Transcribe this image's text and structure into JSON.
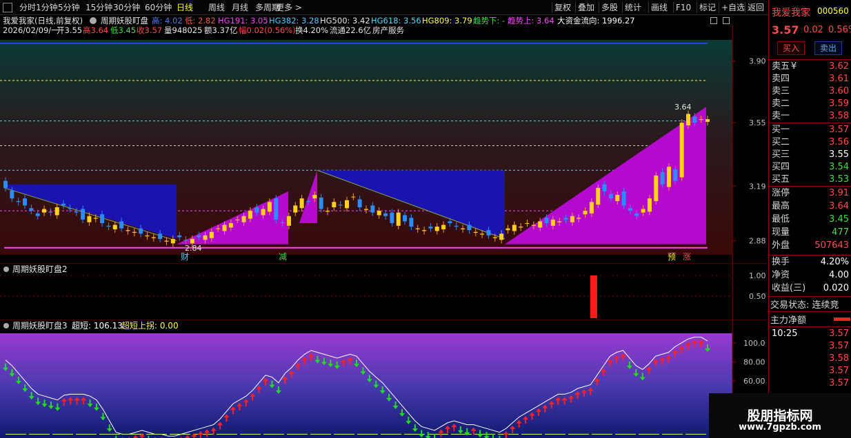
{
  "toolbar": {
    "left": [
      "分时",
      "1分钟",
      "5分钟",
      "15分钟",
      "30分钟",
      "60分钟",
      "日线",
      "周线",
      "月线",
      "多周期",
      "更多 >"
    ],
    "active": "日线",
    "right": [
      "复权",
      "叠加",
      "多股",
      "统计",
      "画线",
      "F10",
      "标记",
      "+自选",
      "返回"
    ]
  },
  "info": {
    "stock": "我爱我家(日线,前复权)",
    "indicator": "周期妖股盯盘",
    "high_label": "高: 4.02",
    "low_label": "低: 2.82",
    "hg191": "HG191: 3.05",
    "hg382": "HG382: 3.28",
    "hg500": "HG500: 3.42",
    "hg618": "HG618: 3.56",
    "hg809": "HG809: 3.79",
    "trend_down": "趋势下: -",
    "trend_up": "趋势上: 3.64",
    "fund_flow": "大资金流向: 1996.27",
    "date": "2026/02/09/一",
    "open": "开3.55",
    "high": "高3.64",
    "low": "低3.45",
    "close": "收3.57",
    "volume": "量948025",
    "amount": "额3.37亿",
    "change": "幅0.02(0.56%)",
    "turnover": "换4.20%",
    "float": "流通22.6亿",
    "sector": "房产服务"
  },
  "price_axis": [
    "3.90",
    "3.55",
    "3.19",
    "2.88"
  ],
  "chart_labels": {
    "low_mark": "2.84",
    "high_mark": "3.64"
  },
  "markers": [
    "财",
    "减",
    "预",
    "涨"
  ],
  "panel2": {
    "title": "周期妖股盯盘2",
    "axis": [
      "1.00",
      "0.50"
    ]
  },
  "panel3": {
    "title": "周期妖股盯盘3",
    "super_short": "超短: 106.13",
    "super_short_up": "超短上拐: 0.00",
    "axis": [
      "100.0",
      "80.00",
      "60.00"
    ]
  },
  "quote": {
    "name": "我爱我家",
    "code": "000560",
    "price": "3.57",
    "change": "0.02",
    "pct": "0.56%",
    "buy_btn": "买入",
    "sell_btn": "卖出",
    "asks": [
      {
        "label": "卖五",
        "extra": "¥",
        "price": "3.62"
      },
      {
        "label": "卖四",
        "price": "3.61"
      },
      {
        "label": "卖三",
        "price": "3.60"
      },
      {
        "label": "卖二",
        "price": "3.59"
      },
      {
        "label": "卖一",
        "price": "3.58"
      }
    ],
    "bids": [
      {
        "label": "买一",
        "price": "3.57"
      },
      {
        "label": "买二",
        "price": "3.56"
      },
      {
        "label": "买三",
        "price": "3.55"
      },
      {
        "label": "买四",
        "price": "3.54"
      },
      {
        "label": "买五",
        "price": "3.53"
      }
    ],
    "stats": [
      {
        "label": "涨停",
        "value": "3.91"
      },
      {
        "label": "最高",
        "value": "3.64"
      },
      {
        "label": "最低",
        "value": "3.45"
      },
      {
        "label": "现量",
        "value": "477"
      },
      {
        "label": "外盘",
        "value": "507643"
      }
    ],
    "stats2": [
      {
        "label": "换手",
        "value": "4.20%"
      },
      {
        "label": "净资",
        "value": "4.00"
      },
      {
        "label": "收益(三)",
        "value": "0.020"
      }
    ],
    "trade_status": "交易状态: 连续竞",
    "main_flow": "主力净额",
    "ticks": [
      {
        "time": "10:25",
        "price": "3.57"
      },
      {
        "time": "",
        "price": "3.57"
      },
      {
        "time": "",
        "price": "3.58"
      },
      {
        "time": "",
        "price": "3.57"
      },
      {
        "time": "",
        "price": "3.57"
      }
    ]
  },
  "watermark": {
    "title": "股朋指标网",
    "url": "www.7gpzb.com"
  }
}
